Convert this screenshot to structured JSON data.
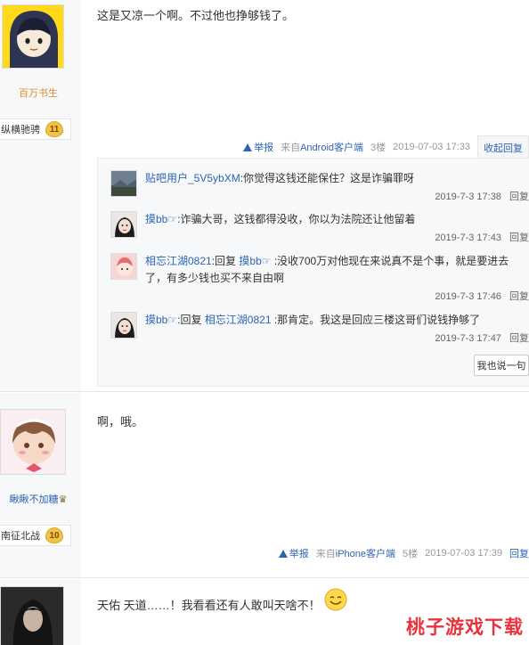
{
  "post1": {
    "content": "这是又凉一个啊。不过他也挣够钱了。",
    "username": "百万书生",
    "badge_label": "纵横驰骋",
    "badge_level": "11",
    "report": "举报",
    "source_prefix": "来自",
    "source_client": "Android客户端",
    "floor": "3楼",
    "time": "2019-07-03 17:33",
    "collapse": "收起回复"
  },
  "comments": [
    {
      "user": "贴吧用户_5V5ybXM",
      "text": ":你觉得这钱还能保住？这是诈骗罪呀",
      "time": "2019-7-3 17:38",
      "reply": "回复"
    },
    {
      "user": "摸bb☞",
      "text": ":诈骗大哥，这钱都得没收，你以为法院还让他留着",
      "time": "2019-7-3 17:43",
      "reply": "回复"
    },
    {
      "user": "相忘江湖0821",
      "reply_word": ":回复",
      "target": "摸bb☞",
      "text": ":没收700万对他现在来说真不是个事，就是要进去了，有多少钱也买不来自由啊",
      "time": "2019-7-3 17:46",
      "reply": "回复"
    },
    {
      "user": "摸bb☞",
      "reply_word": ":回复",
      "target": "相忘江湖0821",
      "text": ":那肯定。我这是回应三楼这哥们说钱挣够了",
      "time": "2019-7-3 17:47",
      "reply": "回复"
    }
  ],
  "say_button": "我也说一句",
  "post2": {
    "content": "啊，哦。",
    "username": "瞅瞅不加糖",
    "badge_label": "南征北战",
    "badge_level": "10",
    "report": "举报",
    "source_prefix": "来自",
    "source_client": "iPhone客户端",
    "floor": "5楼",
    "time": "2019-07-03 17:39",
    "reply": "回复"
  },
  "post3": {
    "content": "天佑 天道……！我看看还有人敢叫天啥不！"
  },
  "watermark": "桃子游戏下载",
  "colors": {
    "link": "#2d64b3",
    "username": "#e08b2a",
    "watermark": "#e8333b"
  }
}
